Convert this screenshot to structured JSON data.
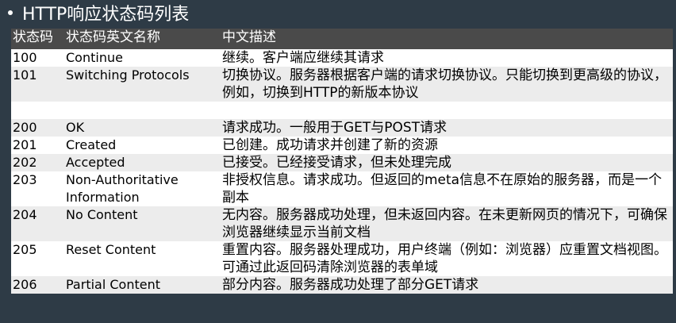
{
  "title": "HTTP响应状态码列表",
  "headers": {
    "code": "状态码",
    "name": "状态码英文名称",
    "desc": "中文描述"
  },
  "rows": [
    {
      "code": "100",
      "name": "Continue",
      "desc": "继续。客户端应继续其请求"
    },
    {
      "code": "101",
      "name": "Switching Protocols",
      "desc": "切换协议。服务器根据客户端的请求切换协议。只能切换到更高级的协议，例如，切换到HTTP的新版本协议"
    },
    {
      "code": "200",
      "name": "OK",
      "desc": "请求成功。一般用于GET与POST请求"
    },
    {
      "code": "201",
      "name": "Created",
      "desc": "已创建。成功请求并创建了新的资源"
    },
    {
      "code": "202",
      "name": "Accepted",
      "desc": "已接受。已经接受请求，但未处理完成"
    },
    {
      "code": "203",
      "name": "Non-Authoritative Information",
      "desc": "非授权信息。请求成功。但返回的meta信息不在原始的服务器，而是一个副本"
    },
    {
      "code": "204",
      "name": "No Content",
      "desc": "无内容。服务器成功处理，但未返回内容。在未更新网页的情况下，可确保浏览器继续显示当前文档"
    },
    {
      "code": "205",
      "name": "Reset Content",
      "desc": "重置内容。服务器处理成功，用户终端（例如：浏览器）应重置文档视图。可通过此返回码清除浏览器的表单域"
    },
    {
      "code": "206",
      "name": "Partial Content",
      "desc": "部分内容。服务器成功处理了部分GET请求"
    }
  ]
}
